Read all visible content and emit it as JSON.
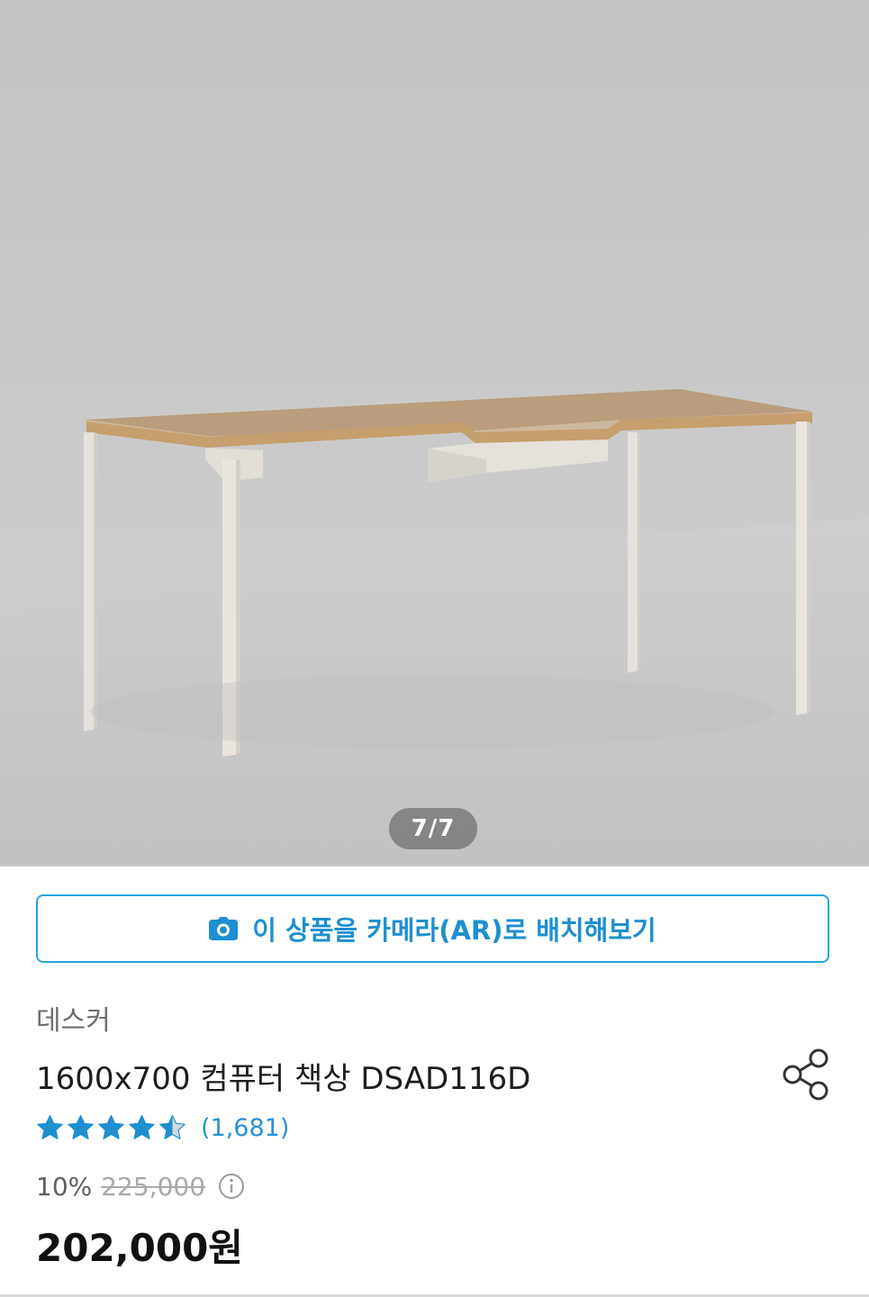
{
  "gallery": {
    "page_indicator": "7/7",
    "image_alt": "desk-product-photo"
  },
  "ar_button": {
    "label": "이 상품을 카메라(AR)로 배치해보기",
    "icon": "camera-icon"
  },
  "product": {
    "brand": "데스커",
    "title": "1600x700 컴퓨터 책상 DSAD116D",
    "rating": {
      "stars": 4.5,
      "max": 5,
      "count_label": "(1,681)"
    },
    "discount_rate": "10%",
    "original_price": "225,000",
    "sale_price": "202,000원"
  },
  "icons": {
    "share": "share-icon",
    "info": "info-icon",
    "star": "star-icon"
  },
  "colors": {
    "accent": "#2aa3de",
    "star": "#1e8fd0",
    "link": "#2a8fd6",
    "original_price": "#a9a9a9",
    "sale_price": "#111111"
  }
}
